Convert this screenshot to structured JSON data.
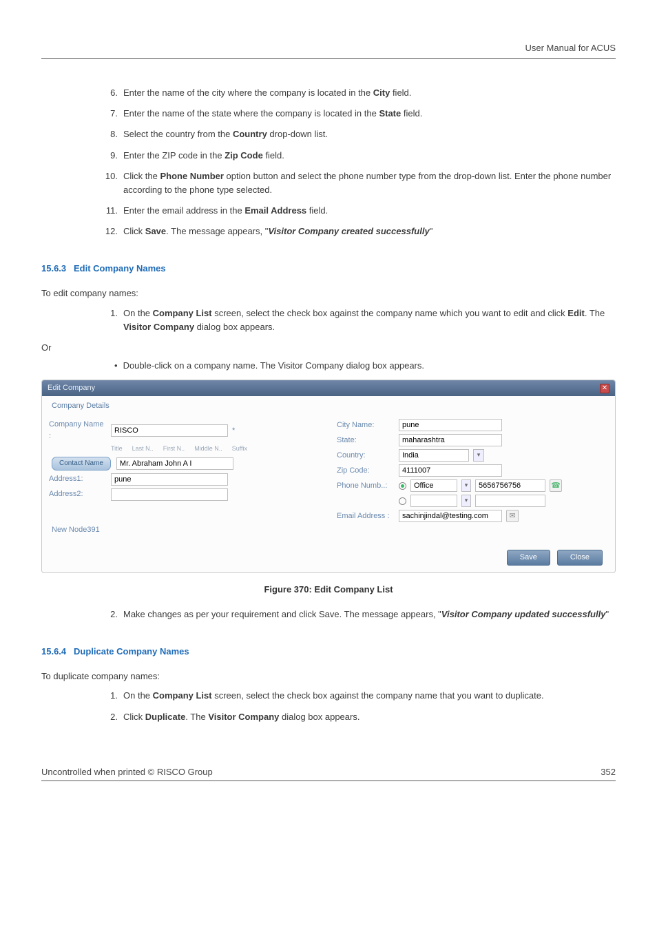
{
  "header": {
    "right_text": "User Manual for ACUS"
  },
  "list_a": [
    {
      "n": "6.",
      "parts": [
        {
          "t": "Enter the name of the city where the company is located in the "
        },
        {
          "t": "City",
          "b": true
        },
        {
          "t": " field."
        }
      ]
    },
    {
      "n": "7.",
      "parts": [
        {
          "t": "Enter the name of the state where the company is located in the "
        },
        {
          "t": "State",
          "b": true
        },
        {
          "t": " field."
        }
      ]
    },
    {
      "n": "8.",
      "parts": [
        {
          "t": "Select the country from the "
        },
        {
          "t": "Country",
          "b": true
        },
        {
          "t": " drop-down list."
        }
      ]
    },
    {
      "n": "9.",
      "parts": [
        {
          "t": "Enter the ZIP code in the "
        },
        {
          "t": "Zip Code",
          "b": true
        },
        {
          "t": " field."
        }
      ]
    },
    {
      "n": "10.",
      "parts": [
        {
          "t": "Click the "
        },
        {
          "t": "Phone Number",
          "b": true
        },
        {
          "t": " option button and select the phone number type from the drop-down list. Enter the phone number according to the phone type selected."
        }
      ]
    },
    {
      "n": "11.",
      "parts": [
        {
          "t": "Enter the email address in the "
        },
        {
          "t": "Email Address",
          "b": true
        },
        {
          "t": " field."
        }
      ]
    },
    {
      "n": "12.",
      "parts": [
        {
          "t": "Click "
        },
        {
          "t": "Save",
          "b": true
        },
        {
          "t": ". The message appears, \""
        },
        {
          "t": "Visitor Company created successfully",
          "bi": true
        },
        {
          "t": "\""
        }
      ]
    }
  ],
  "section_a": {
    "number": "15.6.3",
    "title": "Edit Company Names"
  },
  "intro_a": "To edit company names:",
  "list_b": [
    {
      "n": "1.",
      "parts": [
        {
          "t": "On the "
        },
        {
          "t": "Company List",
          "b": true
        },
        {
          "t": " screen, select the check box against the company name which you want to edit and click "
        },
        {
          "t": "Edit",
          "b": true
        },
        {
          "t": ". The "
        },
        {
          "t": "Visitor Company",
          "b": true
        },
        {
          "t": " dialog box appears."
        }
      ]
    }
  ],
  "or_text": "Or",
  "bullet_b": "Double-click on a company name. The Visitor Company dialog box appears.",
  "dialog": {
    "title": "Edit Company",
    "fieldset_label": "Company Details",
    "labels": {
      "company_name": "Company Name :",
      "contact_name": "Contact Name",
      "address1": "Address1:",
      "address2": "Address2:",
      "new_node": "New Node391",
      "city": "City Name:",
      "state": "State:",
      "country": "Country:",
      "zip": "Zip Code:",
      "phone": "Phone Numb..:",
      "email": "Email Address :"
    },
    "hints": {
      "title": "Title",
      "last": "Last N..",
      "first": "First N..",
      "middle": "Middle N..",
      "suffix": "Suffix"
    },
    "values": {
      "company_name": "RISCO",
      "contact_name": "Mr. Abraham John A I",
      "address1": "pune",
      "address2": "",
      "city": "pune",
      "state": "maharashtra",
      "country": "India",
      "zip": "4111007",
      "phone_type": "Office",
      "phone": "5656756756",
      "email": "sachinjindal@testing.com"
    },
    "buttons": {
      "save": "Save",
      "close": "Close"
    }
  },
  "figure_caption": "Figure 370: Edit Company List",
  "list_c": [
    {
      "n": "2.",
      "parts": [
        {
          "t": "Make changes as per your requirement and click Save. The message appears, \""
        },
        {
          "t": "Visitor Company updated successfully",
          "bi": true
        },
        {
          "t": "\""
        }
      ]
    }
  ],
  "section_b": {
    "number": "15.6.4",
    "title": "Duplicate Company Names"
  },
  "intro_b": "To duplicate company names:",
  "list_d": [
    {
      "n": "1.",
      "parts": [
        {
          "t": "On the "
        },
        {
          "t": "Company List",
          "b": true
        },
        {
          "t": " screen, select the check box against the company name that you want to duplicate."
        }
      ]
    },
    {
      "n": "2.",
      "parts": [
        {
          "t": "Click "
        },
        {
          "t": "Duplicate",
          "b": true
        },
        {
          "t": ". The "
        },
        {
          "t": "Visitor Company",
          "b": true
        },
        {
          "t": " dialog box appears."
        }
      ]
    }
  ],
  "footer": {
    "left": "Uncontrolled when printed © RISCO Group",
    "right": "352"
  }
}
